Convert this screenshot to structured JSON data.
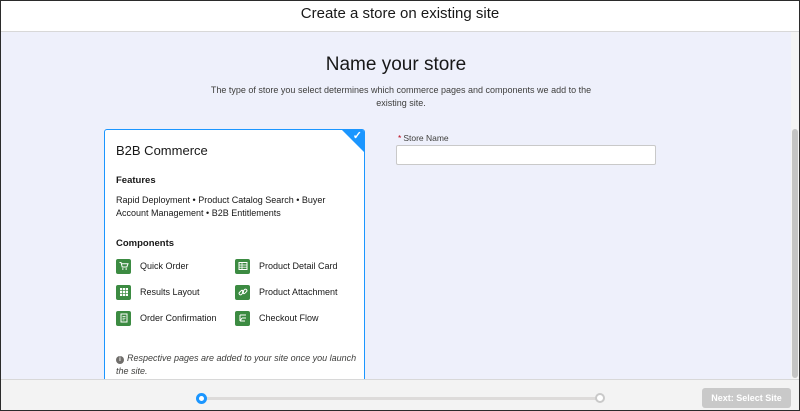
{
  "header": {
    "title": "Create a store on existing site"
  },
  "main": {
    "title": "Name your store",
    "subtitle": "The type of store you select determines which commerce pages and components we add to the existing site."
  },
  "card": {
    "title": "B2B Commerce",
    "selected": true,
    "features_heading": "Features",
    "features_text": "Rapid Deployment • Product Catalog Search • Buyer Account Management • B2B Entitlements",
    "components_heading": "Components",
    "components": [
      {
        "label": "Quick Order",
        "icon": "cart-icon"
      },
      {
        "label": "Product Detail Card",
        "icon": "product-card-icon"
      },
      {
        "label": "Results Layout",
        "icon": "grid-icon"
      },
      {
        "label": "Product Attachment",
        "icon": "link-icon"
      },
      {
        "label": "Order Confirmation",
        "icon": "document-icon"
      },
      {
        "label": "Checkout Flow",
        "icon": "flow-icon"
      }
    ],
    "note": "Respective pages are added to your site once you launch the site."
  },
  "form": {
    "required_marker": "*",
    "store_name_label": "Store Name",
    "store_name_value": "",
    "store_name_placeholder": ""
  },
  "footer": {
    "progress_step": 1,
    "progress_total": 2,
    "next_label": "Next: Select Site"
  },
  "colors": {
    "accent": "#1b96ff",
    "component_icon": "#3c8b42",
    "body_background": "#eef0fb",
    "disabled_button": "#c9c9c9"
  }
}
